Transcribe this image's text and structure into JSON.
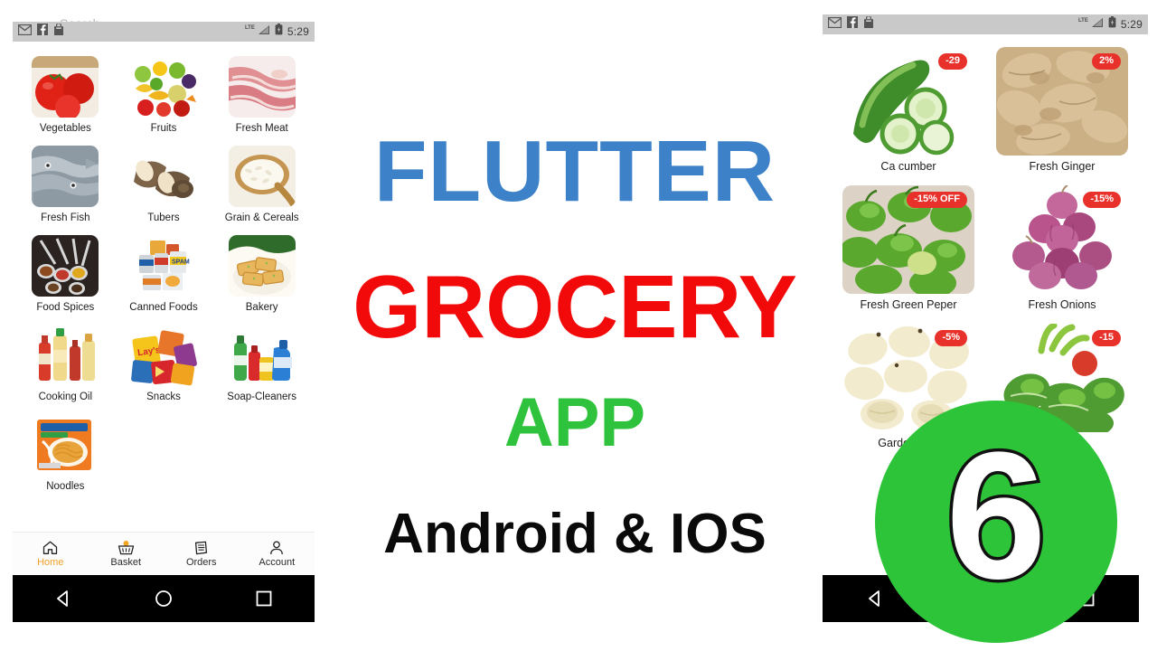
{
  "hero": {
    "line1": "FLUTTER",
    "line2": "GROCERY",
    "line3": "APP",
    "line4": "Android & IOS",
    "color_line1": "#3d82c9",
    "color_line2": "#f20a0a",
    "color_line3": "#2fc23c",
    "color_line4": "#0a0a0a"
  },
  "episode": {
    "number": "6",
    "circle_color": "#2ec43a"
  },
  "status_bar": {
    "time": "5:29",
    "network": "LTE",
    "icons": [
      "gmail-icon",
      "facebook-icon",
      "app-bag-icon"
    ],
    "right_icons": [
      "signal-icon",
      "battery-icon"
    ]
  },
  "left_phone": {
    "search_placeholder": "Search",
    "categories": [
      {
        "label": "Vegetables",
        "image": "tomatoes-image"
      },
      {
        "label": "Fruits",
        "image": "mixed-fruits-image"
      },
      {
        "label": "Fresh Meat",
        "image": "raw-meat-image"
      },
      {
        "label": "Fresh Fish",
        "image": "fresh-fish-image"
      },
      {
        "label": "Tubers",
        "image": "yam-tubers-image"
      },
      {
        "label": "Grain & Cereals",
        "image": "rice-spoon-image"
      },
      {
        "label": "Food Spices",
        "image": "spices-spoons-image"
      },
      {
        "label": "Canned Foods",
        "image": "canned-goods-image"
      },
      {
        "label": "Bakery",
        "image": "bread-slices-image"
      },
      {
        "label": "Cooking Oil",
        "image": "oil-bottles-image"
      },
      {
        "label": "Snacks",
        "image": "chips-packs-image"
      },
      {
        "label": "Soap-Cleaners",
        "image": "detergents-image"
      },
      {
        "label": "Noodles",
        "image": "noodles-pack-image"
      }
    ],
    "tabs": [
      {
        "label": "Home",
        "icon": "home-icon",
        "active": true
      },
      {
        "label": "Basket",
        "icon": "basket-icon",
        "active": false
      },
      {
        "label": "Orders",
        "icon": "orders-icon",
        "active": false
      },
      {
        "label": "Account",
        "icon": "account-icon",
        "active": false
      }
    ]
  },
  "right_phone": {
    "products": [
      {
        "label": "Ca cumber",
        "badge": "-29",
        "image": "cucumber-image"
      },
      {
        "label": "Fresh Ginger",
        "badge": "2%",
        "image": "ginger-image"
      },
      {
        "label": "Fresh Green Peper",
        "badge": "-15% OFF",
        "image": "green-pepper-image"
      },
      {
        "label": "Fresh Onions",
        "badge": "-15%",
        "image": "onions-image"
      },
      {
        "label": "Garden Egg",
        "badge": "-5%",
        "image": "garden-egg-image"
      },
      {
        "label": "",
        "badge": "-15",
        "image": "leafy-greens-image"
      }
    ],
    "badge_color": "#e8312a"
  },
  "system_nav": {
    "buttons": [
      "back-button",
      "home-button",
      "recents-button"
    ]
  }
}
